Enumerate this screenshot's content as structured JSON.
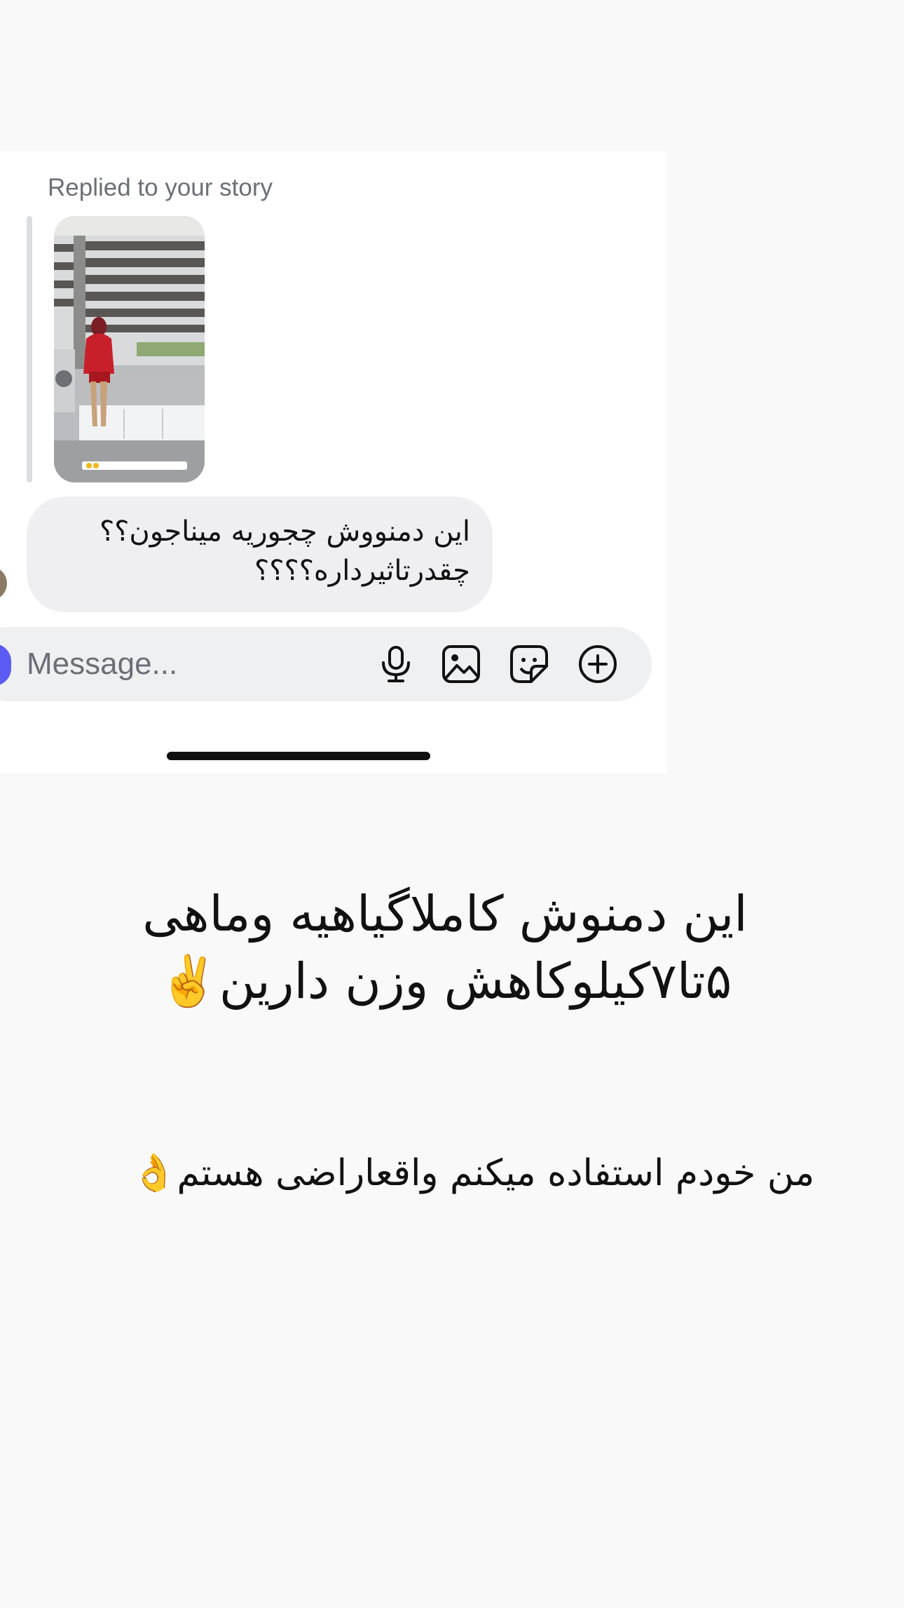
{
  "dm": {
    "reply_label": "Replied to your story",
    "story_thumbnail_name": "story-thumbnail-image",
    "message": {
      "line1": "این دمنووش چجوریه میناجون؟؟",
      "line2": "چقدرتاثیرداره؟؟؟؟"
    },
    "composer": {
      "placeholder": "Message...",
      "icons": [
        "microphone-icon",
        "gallery-icon",
        "sticker-icon",
        "add-icon"
      ]
    }
  },
  "overlay": {
    "caption_line1": "این دمنوش کاملاگیاهیه وماهی",
    "caption_line2": "۵تا۷کیلوکاهش وزن دارین✌️",
    "caption_line3": "من خودم استفاده میکنم واقعاراضی هستم👌"
  },
  "colors": {
    "page_bg": "#f9f9fa",
    "bubble_bg": "#efeff1",
    "camera_button": "#5b5bf5"
  }
}
